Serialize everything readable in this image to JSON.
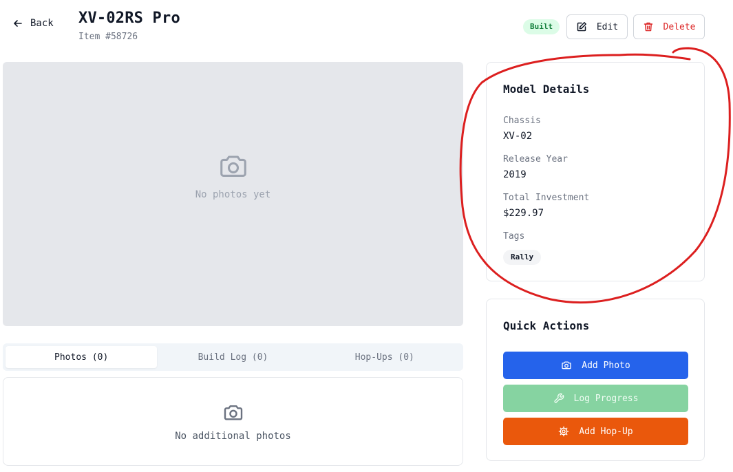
{
  "header": {
    "back_label": "Back",
    "title": "XV-02RS Pro",
    "subtitle": "Item #58726",
    "status_badge": "Built",
    "edit_label": "Edit",
    "delete_label": "Delete"
  },
  "main_photo": {
    "empty_text": "No photos yet",
    "icon": "camera-icon"
  },
  "tabs": [
    {
      "label": "Photos (0)",
      "active": true
    },
    {
      "label": "Build Log (0)",
      "active": false
    },
    {
      "label": "Hop-Ups (0)",
      "active": false
    }
  ],
  "photos_panel": {
    "empty_text": "No additional photos",
    "icon": "camera-icon"
  },
  "details": {
    "title": "Model Details",
    "fields": [
      {
        "label": "Chassis",
        "value": "XV-02"
      },
      {
        "label": "Release Year",
        "value": "2019"
      },
      {
        "label": "Total Investment",
        "value": "$229.97"
      }
    ],
    "tags_label": "Tags",
    "tags": [
      "Rally"
    ]
  },
  "quick_actions": {
    "title": "Quick Actions",
    "buttons": [
      {
        "label": "Add Photo",
        "icon": "camera-icon",
        "color": "#2563eb"
      },
      {
        "label": "Log Progress",
        "icon": "wrench-icon",
        "color": "#86d3a1"
      },
      {
        "label": "Add Hop-Up",
        "icon": "gear-icon",
        "color": "#ea580c"
      }
    ]
  },
  "colors": {
    "badge_bg": "#dcfce7",
    "badge_text": "#15803d",
    "delete_text": "#dc2626",
    "annotation_stroke": "#dc1f1f"
  }
}
